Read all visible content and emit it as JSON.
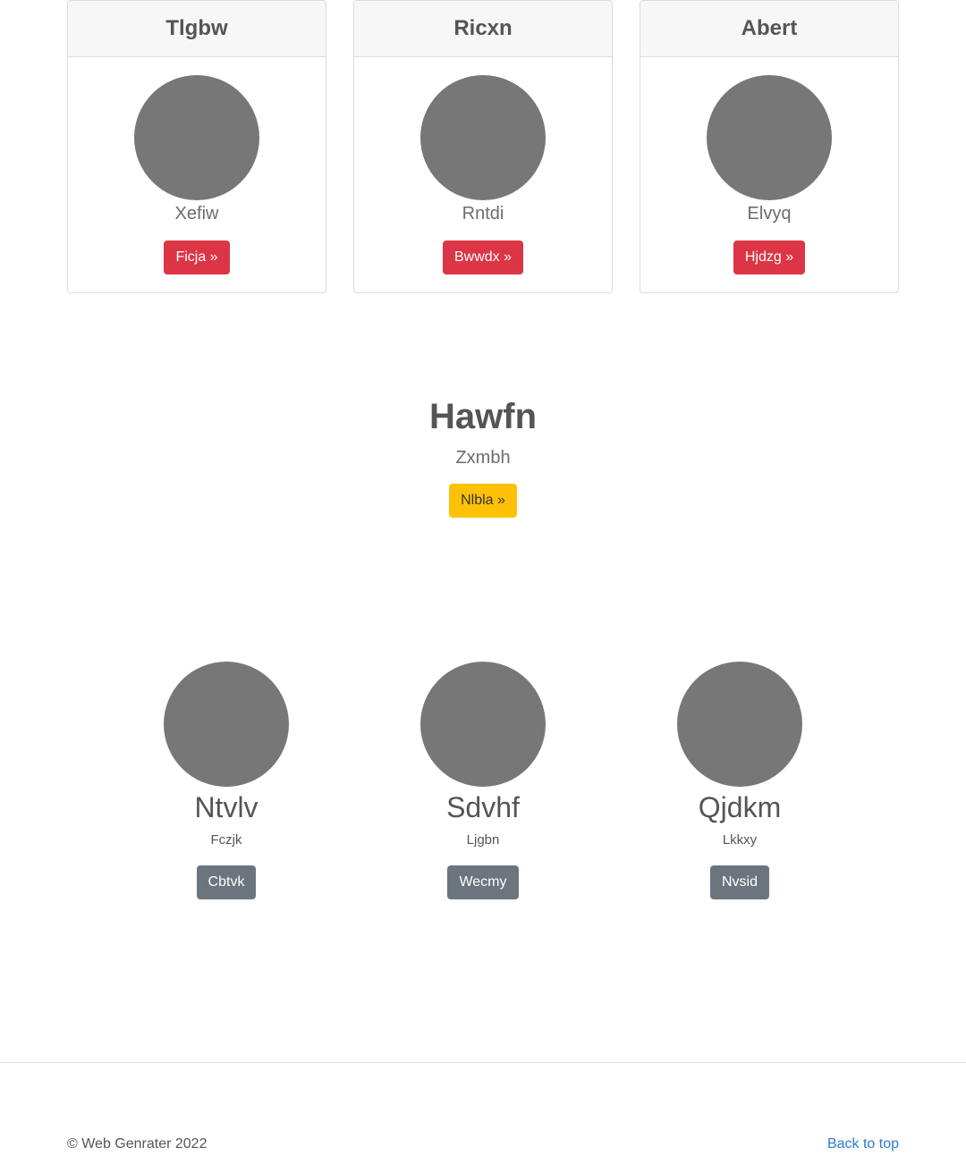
{
  "cards": [
    {
      "title": "Tlgbw",
      "subtitle": "Xefiw",
      "button": "Ficja »"
    },
    {
      "title": "Ricxn",
      "subtitle": "Rntdi",
      "button": "Bwwdx »"
    },
    {
      "title": "Abert",
      "subtitle": "Elvyq",
      "button": "Hjdzg »"
    }
  ],
  "hero": {
    "title": "Hawfn",
    "subtitle": "Zxmbh",
    "button": "Nlbla »"
  },
  "people": [
    {
      "name": "Ntvlv",
      "subtitle": "Fczjk",
      "button": "Cbtvk"
    },
    {
      "name": "Sdvhf",
      "subtitle": "Ljgbn",
      "button": "Wecmy"
    },
    {
      "name": "Qjdkm",
      "subtitle": "Lkkxy",
      "button": "Nvsid"
    }
  ],
  "footer": {
    "copyright": "© Web Genrater 2022",
    "back_to_top": "Back to top"
  },
  "colors": {
    "danger": "#dc3545",
    "warning": "#ffc107",
    "secondary": "#6c757d",
    "link": "#2a7bd3",
    "placeholder": "#777777"
  }
}
